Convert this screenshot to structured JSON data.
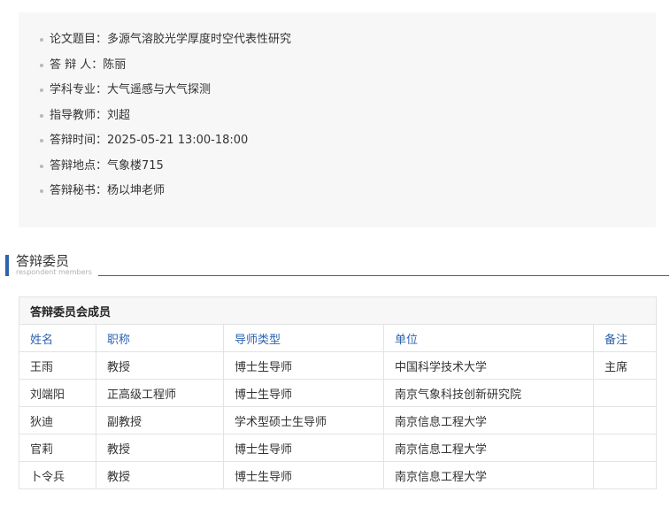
{
  "info": [
    {
      "label": "论文题目：",
      "value": "多源气溶胶光学厚度时空代表性研究"
    },
    {
      "label": "答 辩 人：",
      "value": "陈丽"
    },
    {
      "label": "学科专业：",
      "value": "大气遥感与大气探测"
    },
    {
      "label": "指导教师：",
      "value": "刘超"
    },
    {
      "label": "答辩时间：",
      "value": "2025-05-21 13:00-18:00"
    },
    {
      "label": "答辩地点：",
      "value": "气象楼715"
    },
    {
      "label": "答辩秘书：",
      "value": "杨以坤老师"
    }
  ],
  "section": {
    "title": "答辩委员",
    "subtitle": "respondent members"
  },
  "table": {
    "caption": "答辩委员会成员",
    "headers": [
      "姓名",
      "职称",
      "导师类型",
      "单位",
      "备注"
    ],
    "rows": [
      [
        "王雨",
        "教授",
        "博士生导师",
        "中国科学技术大学",
        "主席"
      ],
      [
        "刘端阳",
        "正高级工程师",
        "博士生导师",
        "南京气象科技创新研究院",
        ""
      ],
      [
        "狄迪",
        "副教授",
        "学术型硕士生导师",
        "南京信息工程大学",
        ""
      ],
      [
        "官莉",
        "教授",
        "博士生导师",
        "南京信息工程大学",
        ""
      ],
      [
        "卜令兵",
        "教授",
        "博士生导师",
        "南京信息工程大学",
        ""
      ]
    ]
  },
  "colors": {
    "accent": "#2e63b0",
    "panel": "#f7f7f7",
    "bullet": "#b9b9b9"
  }
}
